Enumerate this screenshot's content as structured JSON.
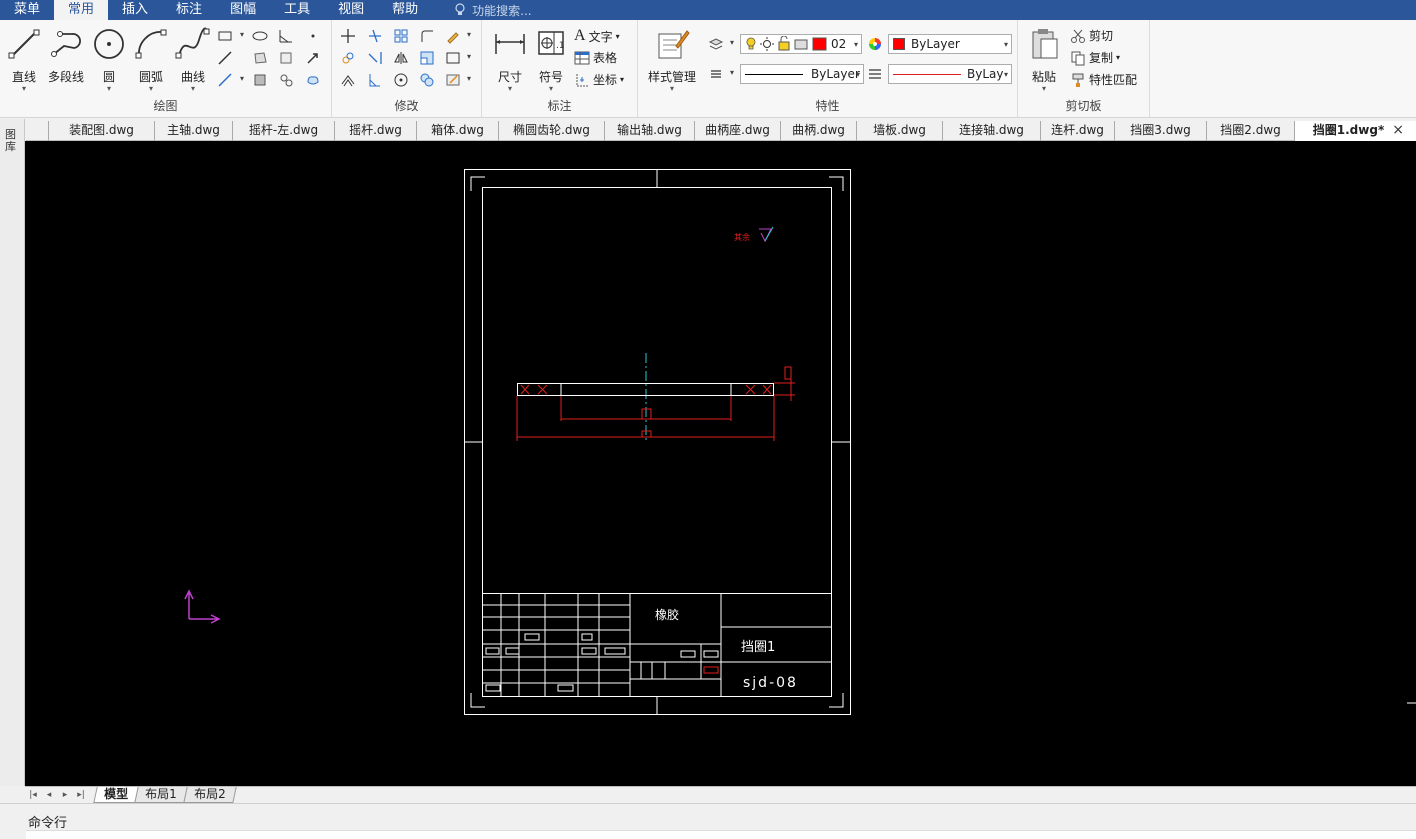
{
  "menubar": {
    "items": [
      "菜单",
      "常用",
      "插入",
      "标注",
      "图幅",
      "工具",
      "视图",
      "帮助"
    ],
    "active_index": 1,
    "search_placeholder": "功能搜索..."
  },
  "ribbon": {
    "groups": {
      "draw": {
        "title": "绘图",
        "tools": [
          "直线",
          "多段线",
          "圆",
          "圆弧",
          "曲线"
        ]
      },
      "modify": {
        "title": "修改"
      },
      "annotate": {
        "title": "标注",
        "tools": [
          "尺寸",
          "符号"
        ],
        "small": [
          "文字",
          "表格",
          "坐标"
        ]
      },
      "properties": {
        "title": "特性",
        "style_manager": "样式管理",
        "layer_value": "02",
        "color_value": "ByLayer",
        "linetype_value": "ByLayer",
        "lineweight_value": "ByLay"
      },
      "clipboard": {
        "title": "剪切板",
        "paste": "粘贴",
        "small": [
          "剪切",
          "复制",
          "特性匹配"
        ]
      }
    }
  },
  "tabs": {
    "documents": [
      "装配图.dwg",
      "主轴.dwg",
      "摇杆-左.dwg",
      "摇杆.dwg",
      "箱体.dwg",
      "椭圆齿轮.dwg",
      "输出轴.dwg",
      "曲柄座.dwg",
      "曲柄.dwg",
      "墙板.dwg",
      "连接轴.dwg",
      "连杆.dwg",
      "挡圈3.dwg",
      "挡圈2.dwg",
      "挡圈1.dwg*"
    ],
    "active_index": 14
  },
  "leftstrip": {
    "label": "图库"
  },
  "drawing": {
    "title_block": {
      "material": "橡胶",
      "part_name": "挡圈1",
      "drawing_number": "sjd-08"
    },
    "roughness_note": "其余"
  },
  "layout_tabs": {
    "items": [
      "模型",
      "布局1",
      "布局2"
    ],
    "active_index": 0
  },
  "command": {
    "label": "命令行"
  },
  "colors": {
    "menubar_bg": "#2b579a",
    "canvas_bg": "#000000",
    "drawing_white": "#ffffff",
    "dimension_red": "#e0201c",
    "centerline_cyan": "#29c8d8",
    "ucs_magenta": "#c040d0",
    "color_swatch_red": "#ff0000"
  }
}
